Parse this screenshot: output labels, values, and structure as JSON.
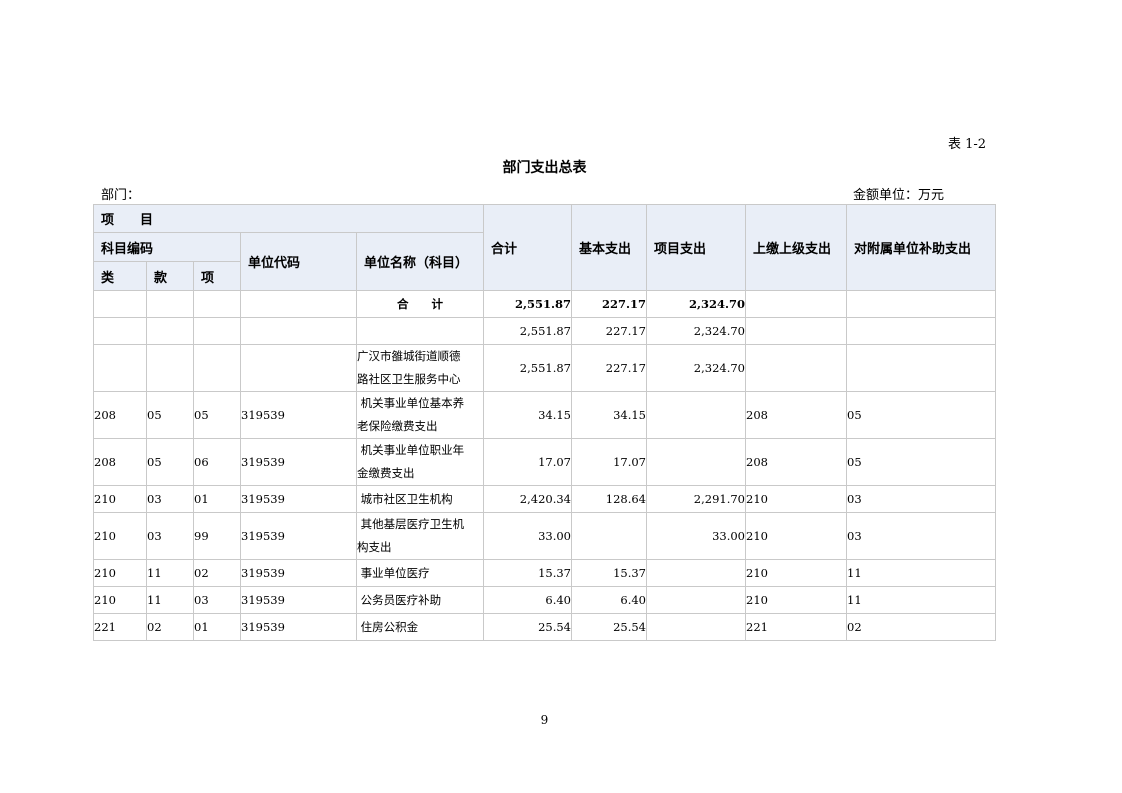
{
  "header": {
    "table_label": "表 1-2",
    "title": "部门支出总表",
    "dept_label": "部门：",
    "unit_label": "金额单位：万元"
  },
  "columns": {
    "project": "项　　目",
    "subject_code": "科目编码",
    "cat": "类",
    "kuan": "款",
    "xiang": "项",
    "unit_code": "单位代码",
    "unit_name": "单位名称（科目）",
    "total": "合计",
    "basic": "基本支出",
    "project_exp": "项目支出",
    "upper": "上缴上级支出",
    "subsidy": "对附属单位补助支出"
  },
  "total_row": {
    "label": "合　　计",
    "total": "2,551.87",
    "basic": "227.17",
    "project_exp": "2,324.70"
  },
  "rows": [
    {
      "cat": "",
      "kuan": "",
      "xiang": "",
      "unit_code": "",
      "name_lines": [
        "",
        ""
      ],
      "total": "2,551.87",
      "basic": "227.17",
      "project_exp": "2,324.70",
      "upper": "",
      "subsidy": ""
    },
    {
      "cat": "",
      "kuan": "",
      "xiang": "",
      "unit_code": "",
      "name_lines": [
        "广汉市雒城街道顺德",
        "路社区卫生服务中心"
      ],
      "total": "2,551.87",
      "basic": "227.17",
      "project_exp": "2,324.70",
      "upper": "",
      "subsidy": ""
    },
    {
      "cat": "208",
      "kuan": "05",
      "xiang": "05",
      "unit_code": "319539",
      "name_lines": [
        " 机关事业单位基本养",
        "老保险缴费支出"
      ],
      "total": "34.15",
      "basic": "34.15",
      "project_exp": "",
      "upper": "208",
      "subsidy": "05"
    },
    {
      "cat": "208",
      "kuan": "05",
      "xiang": "06",
      "unit_code": "319539",
      "name_lines": [
        " 机关事业单位职业年",
        "金缴费支出"
      ],
      "total": "17.07",
      "basic": "17.07",
      "project_exp": "",
      "upper": "208",
      "subsidy": "05"
    },
    {
      "cat": "210",
      "kuan": "03",
      "xiang": "01",
      "unit_code": "319539",
      "name_lines": [
        " 城市社区卫生机构",
        ""
      ],
      "total": "2,420.34",
      "basic": "128.64",
      "project_exp": "2,291.70",
      "upper": "210",
      "subsidy": "03"
    },
    {
      "cat": "210",
      "kuan": "03",
      "xiang": "99",
      "unit_code": "319539",
      "name_lines": [
        " 其他基层医疗卫生机",
        "构支出"
      ],
      "total": "33.00",
      "basic": "",
      "project_exp": "33.00",
      "upper": "210",
      "subsidy": "03"
    },
    {
      "cat": "210",
      "kuan": "11",
      "xiang": "02",
      "unit_code": "319539",
      "name_lines": [
        " 事业单位医疗",
        ""
      ],
      "total": "15.37",
      "basic": "15.37",
      "project_exp": "",
      "upper": "210",
      "subsidy": "11"
    },
    {
      "cat": "210",
      "kuan": "11",
      "xiang": "03",
      "unit_code": "319539",
      "name_lines": [
        " 公务员医疗补助",
        ""
      ],
      "total": "6.40",
      "basic": "6.40",
      "project_exp": "",
      "upper": "210",
      "subsidy": "11"
    },
    {
      "cat": "221",
      "kuan": "02",
      "xiang": "01",
      "unit_code": "319539",
      "name_lines": [
        " 住房公积金",
        ""
      ],
      "total": "25.54",
      "basic": "25.54",
      "project_exp": "",
      "upper": "221",
      "subsidy": "02"
    }
  ],
  "page_number": "9"
}
